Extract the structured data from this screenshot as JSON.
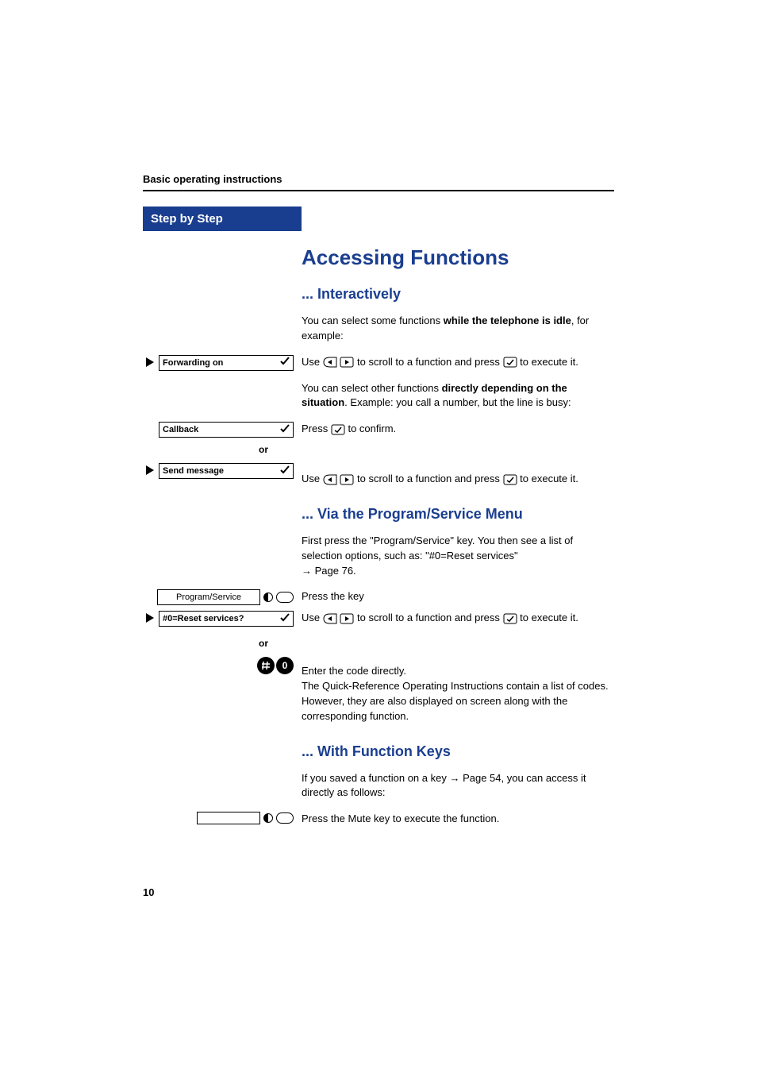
{
  "runningHeader": "Basic operating instructions",
  "stepByStep": "Step by Step",
  "title": "Accessing Functions",
  "section1": {
    "heading": "... Interactively",
    "p1_pre": "You can select some functions ",
    "p1_bold": "while the telephone is idle",
    "p1_post": ", for example:",
    "display1": "Forwarding on",
    "instr1_pre": "Use ",
    "instr1_mid": " to scroll to a function and press ",
    "instr1_post": " to execute it.",
    "p2_pre": "You can select other functions ",
    "p2_bold": "directly depending on the situation",
    "p2_post": ". Example:  you call a number, but the line is busy:",
    "display2": "Callback",
    "instr2_pre": "Press ",
    "instr2_post": " to confirm.",
    "or": "or",
    "display3": "Send message",
    "instr3_pre": "Use ",
    "instr3_mid": " to scroll to a function and press ",
    "instr3_post": " to execute it."
  },
  "section2": {
    "heading": "... Via the Program/Service Menu",
    "p1": "First press the \"Program/Service\" key. You then see a list of selection options, such as: \"#0=Reset services\" ",
    "p1_link": "→ Page 76.",
    "label1": "Program/Service",
    "instr1": "Press the key",
    "display1": "#0=Reset services?",
    "instr2_pre": "Use ",
    "instr2_mid": " to scroll to a function and press ",
    "instr2_post": " to execute it.",
    "or": "or",
    "key1": "#",
    "key2": "0",
    "p2": "Enter the code directly.\nThe Quick-Reference Operating Instructions contain a list of codes. However, they are also displayed on screen along with the corresponding function."
  },
  "section3": {
    "heading": "... With Function Keys",
    "p1_pre": "If you saved a function on a key ",
    "p1_link": "→ Page 54",
    "p1_post": ", you can access it directly as follows:",
    "instr1": "Press the Mute key to execute the function."
  },
  "pageNumber": "10"
}
